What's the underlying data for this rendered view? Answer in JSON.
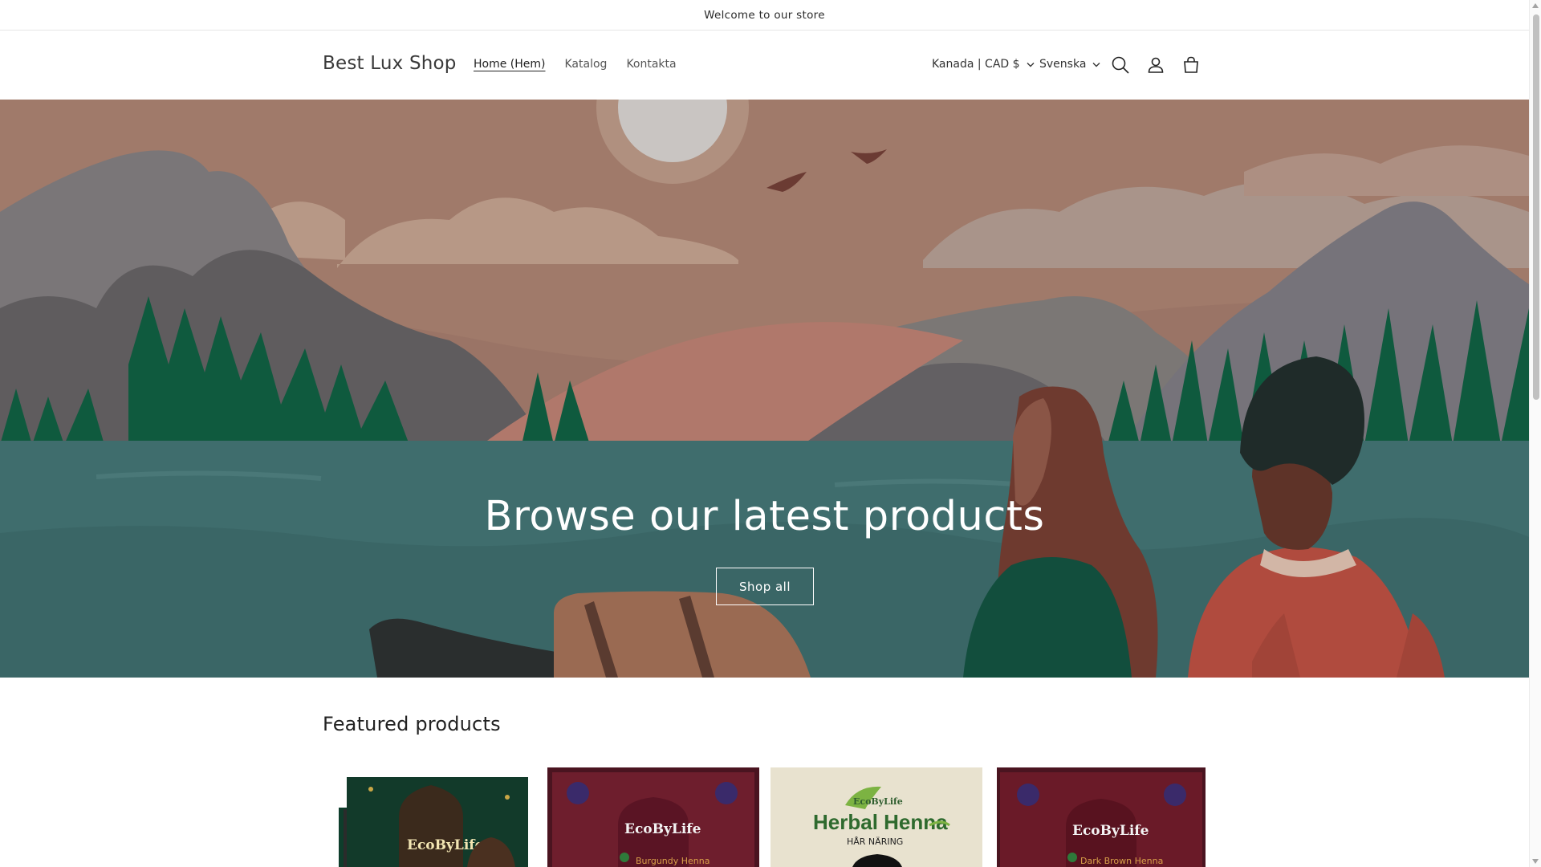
{
  "announcement": {
    "text": "Welcome to our store"
  },
  "header": {
    "logo": "Best Lux Shop",
    "nav": [
      {
        "label": "Home (Hem)",
        "active": true
      },
      {
        "label": "Katalog",
        "active": false
      },
      {
        "label": "Kontakta",
        "active": false
      }
    ],
    "country_selector": "Kanada | CAD $",
    "language_selector": "Svenska",
    "icons": [
      "search-icon",
      "account-icon",
      "cart-icon"
    ]
  },
  "hero": {
    "title": "Browse our latest products",
    "button_label": "Shop all"
  },
  "featured": {
    "title": "Featured products",
    "products": [
      {
        "brand": "EcoByLife",
        "variant": ""
      },
      {
        "brand": "EcoByLife",
        "variant": "Burgundy Henna"
      },
      {
        "brand": "EcoByLife",
        "variant": "Herbal Henna",
        "subtitle": "HÅR NÄRING"
      },
      {
        "brand": "EcoByLife",
        "variant": "Dark Brown Henna"
      }
    ]
  },
  "colors": {
    "hero_sky": "#8d6e63",
    "hero_water": "#3d6b6b",
    "trees": "#0f5a3e",
    "text_dark": "#121212"
  }
}
